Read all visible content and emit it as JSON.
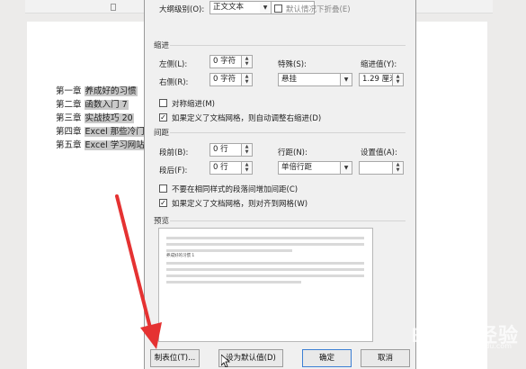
{
  "document": {
    "lines": [
      {
        "label": "第一章",
        "text": "养成好的习惯"
      },
      {
        "label": "第二章",
        "text": "函数入门 7"
      },
      {
        "label": "第三章",
        "text": "实战技巧 20"
      },
      {
        "label": "第四章",
        "text": "Excel 那些冷门"
      },
      {
        "label": "第五章",
        "text": "Excel 学习网站"
      }
    ]
  },
  "dialog": {
    "outline_level_label": "大纲级别(O):",
    "outline_level_value": "正文文本",
    "collapse_default_label": "默认情况下折叠(E)",
    "indent_section": "缩进",
    "left_label": "左侧(L):",
    "left_value": "0 字符",
    "right_label": "右侧(R):",
    "right_value": "0 字符",
    "special_label": "特殊(S):",
    "special_value": "悬挂",
    "indent_value_label": "缩进值(Y):",
    "indent_value": "1.29 厘米",
    "mirror_indent_label": "对称缩进(M)",
    "auto_adjust_indent_label": "如果定义了文档网格，则自动调整右缩进(D)",
    "spacing_section": "间距",
    "before_label": "段前(B):",
    "before_value": "0 行",
    "after_label": "段后(F):",
    "after_value": "0 行",
    "line_spacing_label": "行距(N):",
    "line_spacing_value": "单倍行距",
    "set_value_label": "设置值(A):",
    "set_value": "",
    "no_space_same_style_label": "不要在相同样式的段落间增加间距(C)",
    "snap_to_grid_label": "如果定义了文档网格，则对齐到网格(W)",
    "preview_section": "预览",
    "preview_sample_text": "养成好的习惯 1",
    "buttons": {
      "tabs": "制表位(T)...",
      "set_default": "设为默认值(D)",
      "ok": "确定",
      "cancel": "取消"
    },
    "checkboxes": {
      "collapse_default": false,
      "mirror_indent": false,
      "auto_adjust_indent": true,
      "no_space_same_style": false,
      "snap_to_grid": true
    }
  },
  "watermark": {
    "brand": "Baidu 经验",
    "url": "jingyan.baidu.com"
  },
  "colors": {
    "annotation_arrow": "#e53232",
    "dialog_bg": "#f0f0f0",
    "highlight": "#c9c9c9"
  }
}
